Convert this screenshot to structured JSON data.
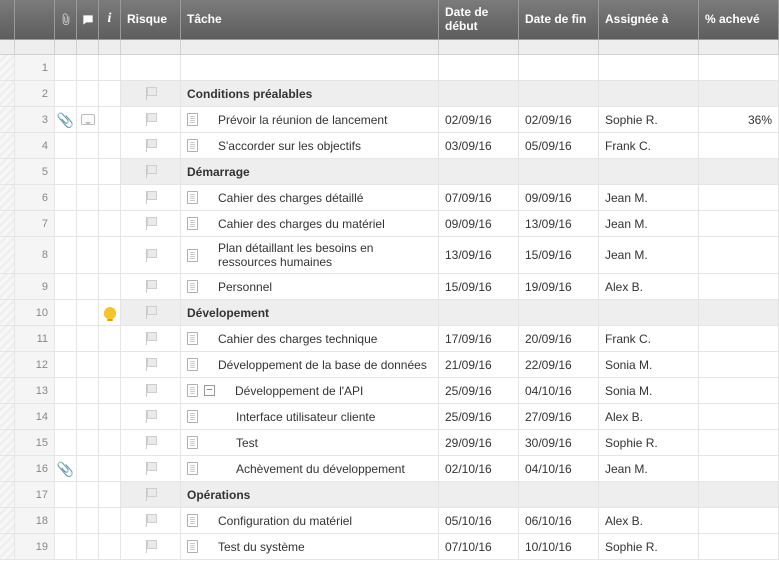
{
  "columns": {
    "risk": "Risque",
    "task": "Tâche",
    "start": "Date de début",
    "end": "Date de fin",
    "assignee": "Assignée à",
    "pct": "% achevé"
  },
  "rows": [
    {
      "n": 1,
      "type": "blank"
    },
    {
      "n": 2,
      "type": "group",
      "task": "Conditions préalables"
    },
    {
      "n": 3,
      "type": "task",
      "task": "Prévoir la réunion de lancement",
      "start": "02/09/16",
      "end": "02/09/16",
      "assignee": "Sophie R.",
      "pct": "36%",
      "has_attach": true,
      "has_comment": true
    },
    {
      "n": 4,
      "type": "task",
      "task": "S'accorder sur les objectifs",
      "start": "03/09/16",
      "end": "05/09/16",
      "assignee": "Frank C."
    },
    {
      "n": 5,
      "type": "group",
      "task": "Démarrage"
    },
    {
      "n": 6,
      "type": "task",
      "task": "Cahier des charges détaillé",
      "start": "07/09/16",
      "end": "09/09/16",
      "assignee": "Jean M."
    },
    {
      "n": 7,
      "type": "task",
      "task": "Cahier des charges du matériel",
      "start": "09/09/16",
      "end": "13/09/16",
      "assignee": "Jean M."
    },
    {
      "n": 8,
      "type": "task",
      "task": "Plan détaillant les besoins en ressources humaines",
      "start": "13/09/16",
      "end": "15/09/16",
      "assignee": "Jean M."
    },
    {
      "n": 9,
      "type": "task",
      "task": "Personnel",
      "start": "15/09/16",
      "end": "19/09/16",
      "assignee": "Alex B."
    },
    {
      "n": 10,
      "type": "group",
      "task": "Dévelopement",
      "has_bell": true
    },
    {
      "n": 11,
      "type": "task",
      "task": "Cahier des charges technique",
      "start": "17/09/16",
      "end": "20/09/16",
      "assignee": "Frank C."
    },
    {
      "n": 12,
      "type": "task",
      "task": "Développement de la base de données",
      "start": "21/09/16",
      "end": "22/09/16",
      "assignee": "Sonia M."
    },
    {
      "n": 13,
      "type": "task",
      "task": "Développement de l'API",
      "start": "25/09/16",
      "end": "04/10/16",
      "assignee": "Sonia M.",
      "collapsible": true
    },
    {
      "n": 14,
      "type": "task",
      "task": "Interface utilisateur cliente",
      "start": "25/09/16",
      "end": "27/09/16",
      "assignee": "Alex B.",
      "indent": 2
    },
    {
      "n": 15,
      "type": "task",
      "task": "Test",
      "start": "29/09/16",
      "end": "30/09/16",
      "assignee": "Sophie R.",
      "indent": 2
    },
    {
      "n": 16,
      "type": "task",
      "task": "Achèvement du développement",
      "start": "02/10/16",
      "end": "04/10/16",
      "assignee": "Jean M.",
      "indent": 2,
      "has_attach": true
    },
    {
      "n": 17,
      "type": "group",
      "task": "Opérations"
    },
    {
      "n": 18,
      "type": "task",
      "task": "Configuration du matériel",
      "start": "05/10/16",
      "end": "06/10/16",
      "assignee": "Alex B."
    },
    {
      "n": 19,
      "type": "task",
      "task": "Test du système",
      "start": "07/10/16",
      "end": "10/10/16",
      "assignee": "Sophie R."
    }
  ]
}
